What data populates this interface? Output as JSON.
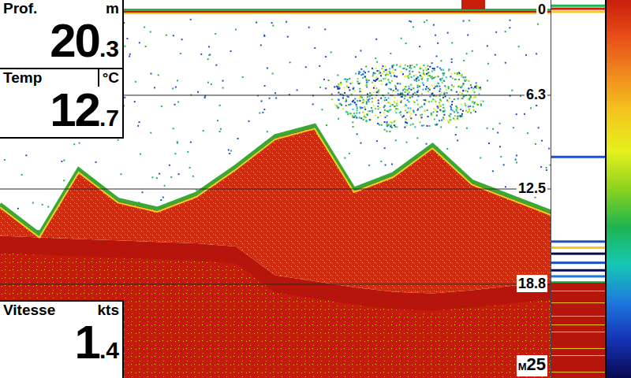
{
  "depth_panel": {
    "label": "Prof.",
    "unit": "m",
    "value_int": "20",
    "value_dec": ".3"
  },
  "temp_panel": {
    "label": "Temp",
    "unit": "°C",
    "value_int": "12",
    "value_dec": ".7"
  },
  "speed_panel": {
    "label": "Vitesse",
    "unit": "kts",
    "value_int": "1",
    "value_dec": ".4"
  },
  "depth_scale": {
    "ticks": [
      "0",
      "6.3",
      "12.5",
      "18.8"
    ],
    "unit": "M",
    "max": "25"
  },
  "sonar": {
    "structure_top_m": [
      13.5,
      15.5,
      11.2,
      13.2,
      13.8,
      12.8,
      11.0,
      9.0,
      8.3,
      12.5,
      11.5,
      9.6,
      12.0,
      13.0,
      14.0
    ],
    "bottom_depth_m": [
      15.6,
      15.7,
      15.8,
      15.9,
      16.0,
      16.1,
      16.3,
      18.2,
      18.6,
      19.0,
      19.3,
      19.4,
      19.2,
      18.9,
      18.7
    ],
    "school": {
      "from": 0.6,
      "to": 0.88,
      "top_m": 4.2,
      "bottom_m": 8.4
    }
  },
  "ascope_returns": [
    {
      "depth": 0.3,
      "color": "#1eb450"
    },
    {
      "depth": 0.5,
      "color": "#c81e0a"
    },
    {
      "depth": 0.7,
      "color": "#f4c81e"
    },
    {
      "depth": 10.3,
      "color": "#1e50c8"
    },
    {
      "depth": 15.9,
      "color": "#1e50c8"
    },
    {
      "depth": 16.3,
      "color": "#f4c81e"
    },
    {
      "depth": 16.7,
      "color": "#0a0a50"
    },
    {
      "depth": 17.3,
      "color": "#1e50c8"
    },
    {
      "depth": 17.8,
      "color": "#0a0a50"
    },
    {
      "depth": 18.2,
      "color": "#1e78dc"
    },
    {
      "depth": 18.6,
      "color": "#1eb450"
    }
  ],
  "color_scale": [
    "#c81e0a",
    "#e8501a",
    "#f08c1e",
    "#f4c81e",
    "#e6f01e",
    "#8cd21e",
    "#1eb450",
    "#14c8b4",
    "#1e78dc",
    "#1432b4",
    "#0a0a50"
  ]
}
